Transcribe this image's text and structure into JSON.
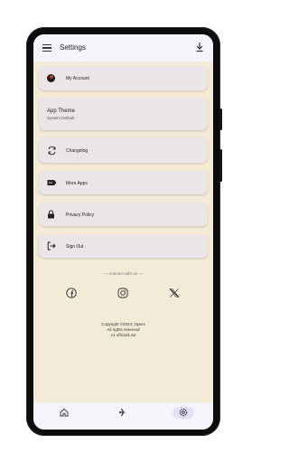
{
  "header": {
    "title": "Settings"
  },
  "menu": {
    "my_account": "My Account",
    "app_theme_title": "App Theme",
    "app_theme_value": "System Default",
    "changelog": "Changelog",
    "more_apps": "More Apps",
    "privacy_policy": "Privacy Policy",
    "sign_out": "Sign Out"
  },
  "footer": {
    "connect": "— connect with us —",
    "copyright": "Copyright ©2024, Operx",
    "rights": "All rights reserved",
    "version": "v1 official1.62"
  },
  "icons": {
    "menu": "hamburger-menu-icon",
    "download": "download-icon",
    "changelog": "sync-icon",
    "more_apps": "tag-icon",
    "privacy": "lock-icon",
    "sign_out": "logout-icon",
    "facebook": "facebook-icon",
    "instagram": "instagram-icon",
    "x": "x-icon",
    "home": "home-icon",
    "explore": "plane-icon",
    "settings": "settings-icon"
  },
  "colors": {
    "screen_bg": "#f4ead8",
    "card_bg": "#ebe5e8",
    "bar_bg": "#f6f4fb",
    "active_nav": "#e6dff5"
  }
}
